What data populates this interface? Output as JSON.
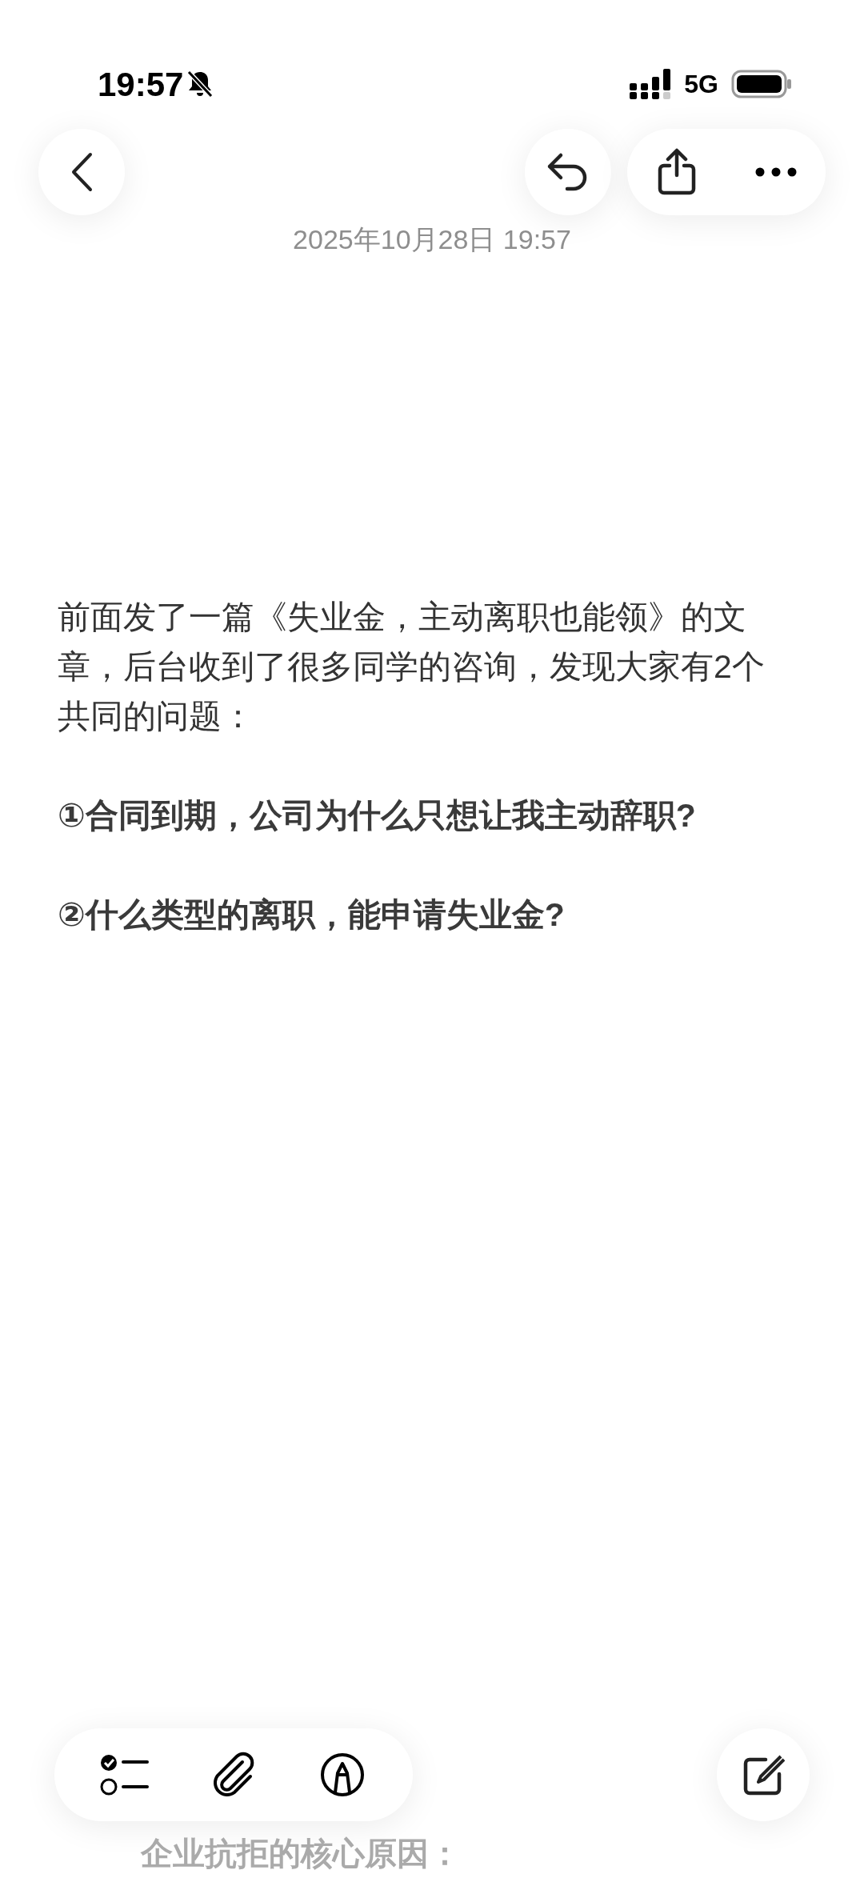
{
  "status_bar": {
    "time": "19:57",
    "network": "5G"
  },
  "note": {
    "date": "2025年10月28日 19:57",
    "paragraphs": [
      {
        "kind": "plain",
        "text": "前面发了一篇《失业金，主动离职也能领》的文章，后台收到了很多同学的咨询，发现大家有2个共同的问题："
      },
      {
        "kind": "bold",
        "text": "①合同到期，公司为什么只想让我主动辞职?"
      },
      {
        "kind": "bold",
        "text": "②什么类型的离职，能申请失业金?"
      }
    ],
    "faded_text": "企业抗拒的核心原因："
  }
}
